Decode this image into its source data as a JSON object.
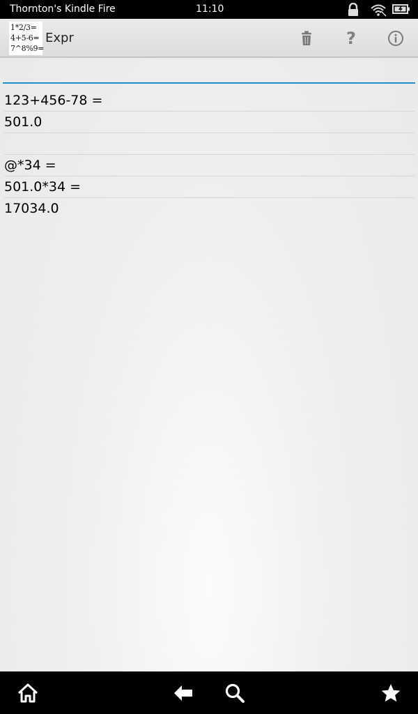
{
  "status_bar": {
    "device_name": "Thornton's Kindle Fire",
    "time": "11:10",
    "icons": [
      "lock-icon",
      "wifi-icon",
      "battery-icon"
    ]
  },
  "action_bar": {
    "logo_lines": [
      "1*2/3=",
      "4+5-6=",
      "7^8%9="
    ],
    "title": "Expr",
    "actions": [
      "trash-icon",
      "help-icon",
      "info-icon"
    ]
  },
  "input": {
    "value": "",
    "placeholder": ""
  },
  "history": [
    "123+456-78 =",
    "501.0",
    "",
    "@*34 =",
    "501.0*34 =",
    "17034.0"
  ],
  "nav_bar": {
    "icons": [
      "home-icon",
      "back-icon",
      "search-icon",
      "favorites-icon"
    ]
  },
  "colors": {
    "accent": "#1e90c8",
    "status_bar": "#000000",
    "action_bar": "#e3e3e3"
  }
}
